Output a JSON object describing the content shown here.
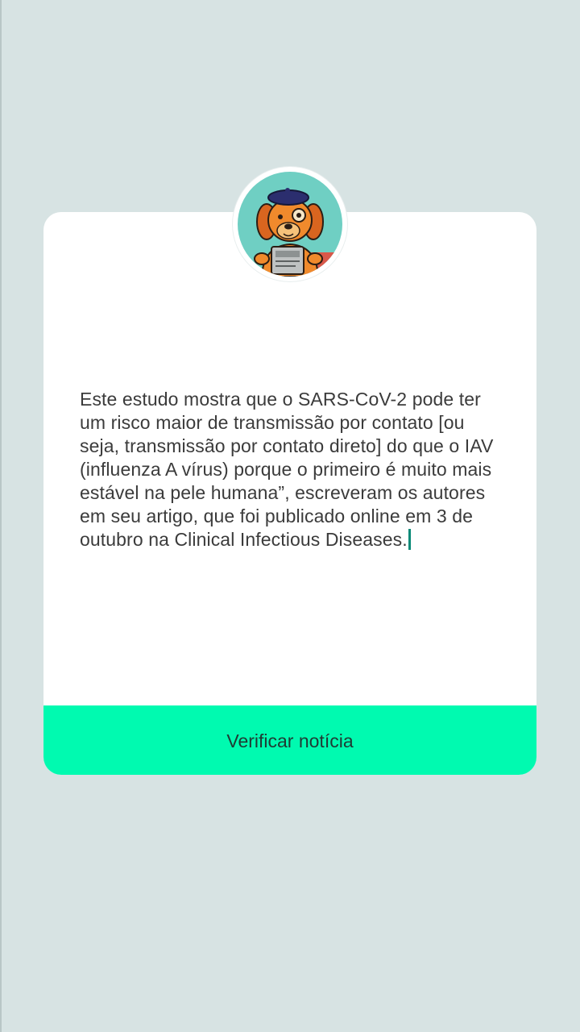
{
  "card": {
    "text": "Este estudo mostra que o SARS-CoV-2 pode ter um risco maior de transmissão por contato [ou seja, transmissão por contato direto] do que o IAV (influenza A vírus) porque o primeiro é muito mais estável na pele humana”, escreveram os autores em seu artigo, que foi publicado online em 3 de outubro na Clinical Infectious Diseases.",
    "button_label": "Verificar notícia"
  },
  "avatar": {
    "icon": "detective-dog-mascot-icon"
  },
  "colors": {
    "background": "#d7e3e3",
    "card": "#ffffff",
    "button": "#00fab0",
    "avatar_bg": "#6fcfc3",
    "caret": "#0a8a78"
  }
}
